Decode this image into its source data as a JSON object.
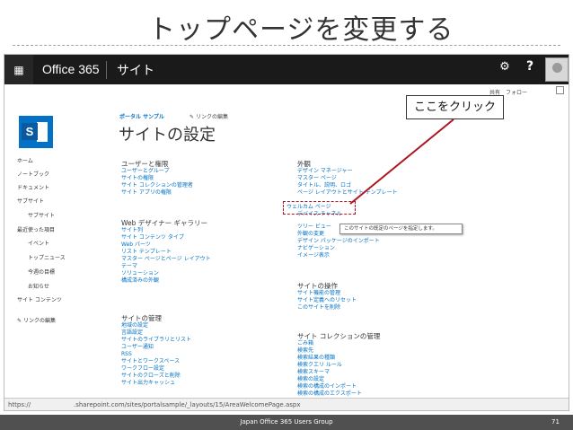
{
  "slide": {
    "title": "トップページを変更する",
    "footer_text": "Japan Office 365 Users Group",
    "page_number": "71"
  },
  "suitebar": {
    "brand": "Office 365",
    "site_nav": "サイト",
    "help_label": "?"
  },
  "share_row": {
    "share_label": "共有",
    "follow_label": "フォロー"
  },
  "breadcrumb": {
    "parent": "ポータル サンプル",
    "edit_links": "リンクの編集"
  },
  "page_title": "サイトの設定",
  "quick_launch": [
    "ホーム",
    "ノートブック",
    "ドキュメント",
    "サブサイト",
    "サブサイト",
    "最近使った項目",
    "イベント",
    "トップニュース",
    "今週の目標",
    "お知らせ",
    "サイト コンテンツ",
    "リンクの編集"
  ],
  "sections": {
    "users": {
      "heading": "ユーザーと権限",
      "links": [
        "ユーザーとグループ",
        "サイトの権限",
        "サイト コレクションの管理者",
        "サイト アプリの権限"
      ]
    },
    "web_designer": {
      "heading": "Web デザイナー ギャラリー",
      "links": [
        "サイト列",
        "サイト コンテンツ タイプ",
        "Web パーツ",
        "リスト テンプレート",
        "マスター ページとページ レイアウト",
        "テーマ",
        "ソリューション",
        "構成済みの外観"
      ]
    },
    "site_admin": {
      "heading": "サイトの管理",
      "links": [
        "地域の設定",
        "言語設定",
        "サイトのライブラリとリスト",
        "ユーザー通知",
        "RSS",
        "サイトとワークスペース",
        "ワークフロー設定",
        "サイトのクローズと削除",
        "サイト出力キャッシュ"
      ]
    },
    "look": {
      "heading": "外観",
      "links": [
        "デザイン マネージャー",
        "マスター ページ",
        "タイトル、説明、ロゴ",
        "ページ レイアウトとサイト テンプレート",
        "ウェルカム ページ",
        "デバイス チャネル",
        "ツリー ビュー",
        "外観の変更",
        "デザイン パッケージのインポート",
        "ナビゲーション",
        "イメージ表示"
      ]
    },
    "site_actions": {
      "heading": "サイトの操作",
      "links": [
        "サイト機能の管理",
        "サイト定義へのリセット",
        "このサイトを削除"
      ]
    },
    "collection_admin": {
      "heading": "サイト コレクションの管理",
      "links": [
        "ごみ箱",
        "検索先",
        "検索結果の種類",
        "検索クエリ ルール",
        "検索スキーマ",
        "検索の設定",
        "検索の構成のインポート",
        "検索の構成のエクスポート"
      ]
    }
  },
  "callout": {
    "text": "ここをクリック"
  },
  "tooltip": {
    "text": "このサイトの既定のページを指定します。"
  },
  "statusbar": {
    "protocol": "https://",
    "url": ".sharepoint.com/sites/portalsample/_layouts/15/AreaWelcomePage.aspx"
  },
  "colors": {
    "suitebar": "#1a1a1a",
    "link": "#0072c6",
    "logo": "#0372c6",
    "highlight": "#b0141e",
    "footer": "#505050"
  }
}
